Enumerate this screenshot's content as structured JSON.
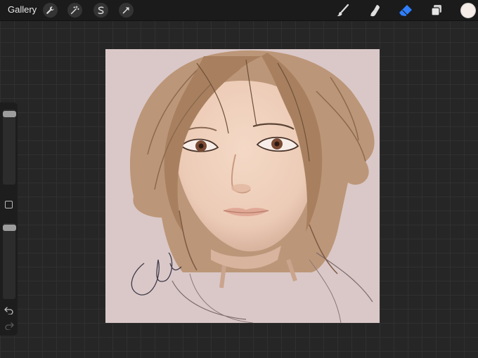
{
  "app": {
    "gallery_label": "Gallery"
  },
  "toolbar_left": [
    {
      "name": "actions-wrench-icon"
    },
    {
      "name": "adjustments-magic-wand-icon"
    },
    {
      "name": "selection-s-icon"
    },
    {
      "name": "transform-arrow-icon"
    }
  ],
  "toolbar_right": {
    "tools": [
      "brush-icon",
      "smudge-icon",
      "eraser-icon",
      "layers-icon"
    ],
    "active_tool": "eraser-icon",
    "accent_color": "#2f7fff",
    "current_color": "#f6ece8"
  },
  "sidebar": {
    "brush_size_level": 0.0,
    "opacity_level": 0.0,
    "controls": [
      "modify-button",
      "undo-icon",
      "redo-icon"
    ]
  },
  "canvas": {
    "background_color": "#dac8c8"
  }
}
